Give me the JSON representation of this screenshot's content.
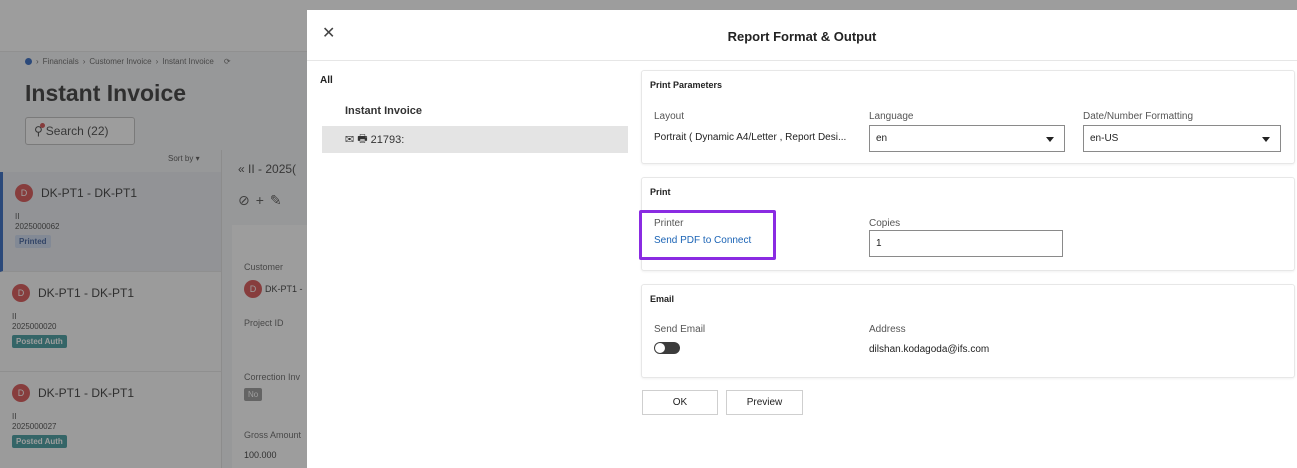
{
  "background": {
    "breadcrumb": [
      "Financials",
      "Customer Invoice",
      "Instant Invoice"
    ],
    "page_title": "Instant Invoice",
    "search_label": "Search (22)",
    "sort_by": "Sort by",
    "detail_header": "II - 2025(",
    "cards": [
      {
        "name": "DK-PT1 - DK-PT1",
        "avatar": "D",
        "type": "II",
        "number": "2025000062",
        "status": "Printed"
      },
      {
        "name": "DK-PT1 - DK-PT1",
        "avatar": "D",
        "type": "II",
        "number": "2025000020",
        "status": "Posted Auth"
      },
      {
        "name": "DK-PT1 - DK-PT1",
        "avatar": "D",
        "type": "II",
        "number": "2025000027",
        "status": "Posted Auth"
      }
    ],
    "detail": {
      "customer_label": "Customer",
      "customer_value": "DK-PT1 -",
      "project_label": "Project ID",
      "correction_label": "Correction Inv",
      "correction_value": "No",
      "gross_label": "Gross Amount",
      "gross_value": "100.000"
    }
  },
  "dialog": {
    "title": "Report Format & Output",
    "tree": {
      "all_label": "All",
      "report_label": "Instant Invoice",
      "item_label": "21793:"
    },
    "print_parameters": {
      "title": "Print Parameters",
      "layout_label": "Layout",
      "layout_value": "Portrait ( Dynamic A4/Letter , Report Desi...",
      "language_label": "Language",
      "language_value": "en",
      "formatting_label": "Date/Number Formatting",
      "formatting_value": "en-US"
    },
    "print": {
      "title": "Print",
      "printer_label": "Printer",
      "printer_value": "Send PDF to Connect",
      "copies_label": "Copies",
      "copies_value": "1"
    },
    "email": {
      "title": "Email",
      "send_email_label": "Send Email",
      "send_email_on": false,
      "address_label": "Address",
      "address_value": "dilshan.kodagoda@ifs.com"
    },
    "buttons": {
      "ok": "OK",
      "preview": "Preview"
    }
  },
  "colors": {
    "highlight": "#8a2be2",
    "link": "#1a63b5",
    "overlay": "rgba(60,60,60,0.5)"
  }
}
